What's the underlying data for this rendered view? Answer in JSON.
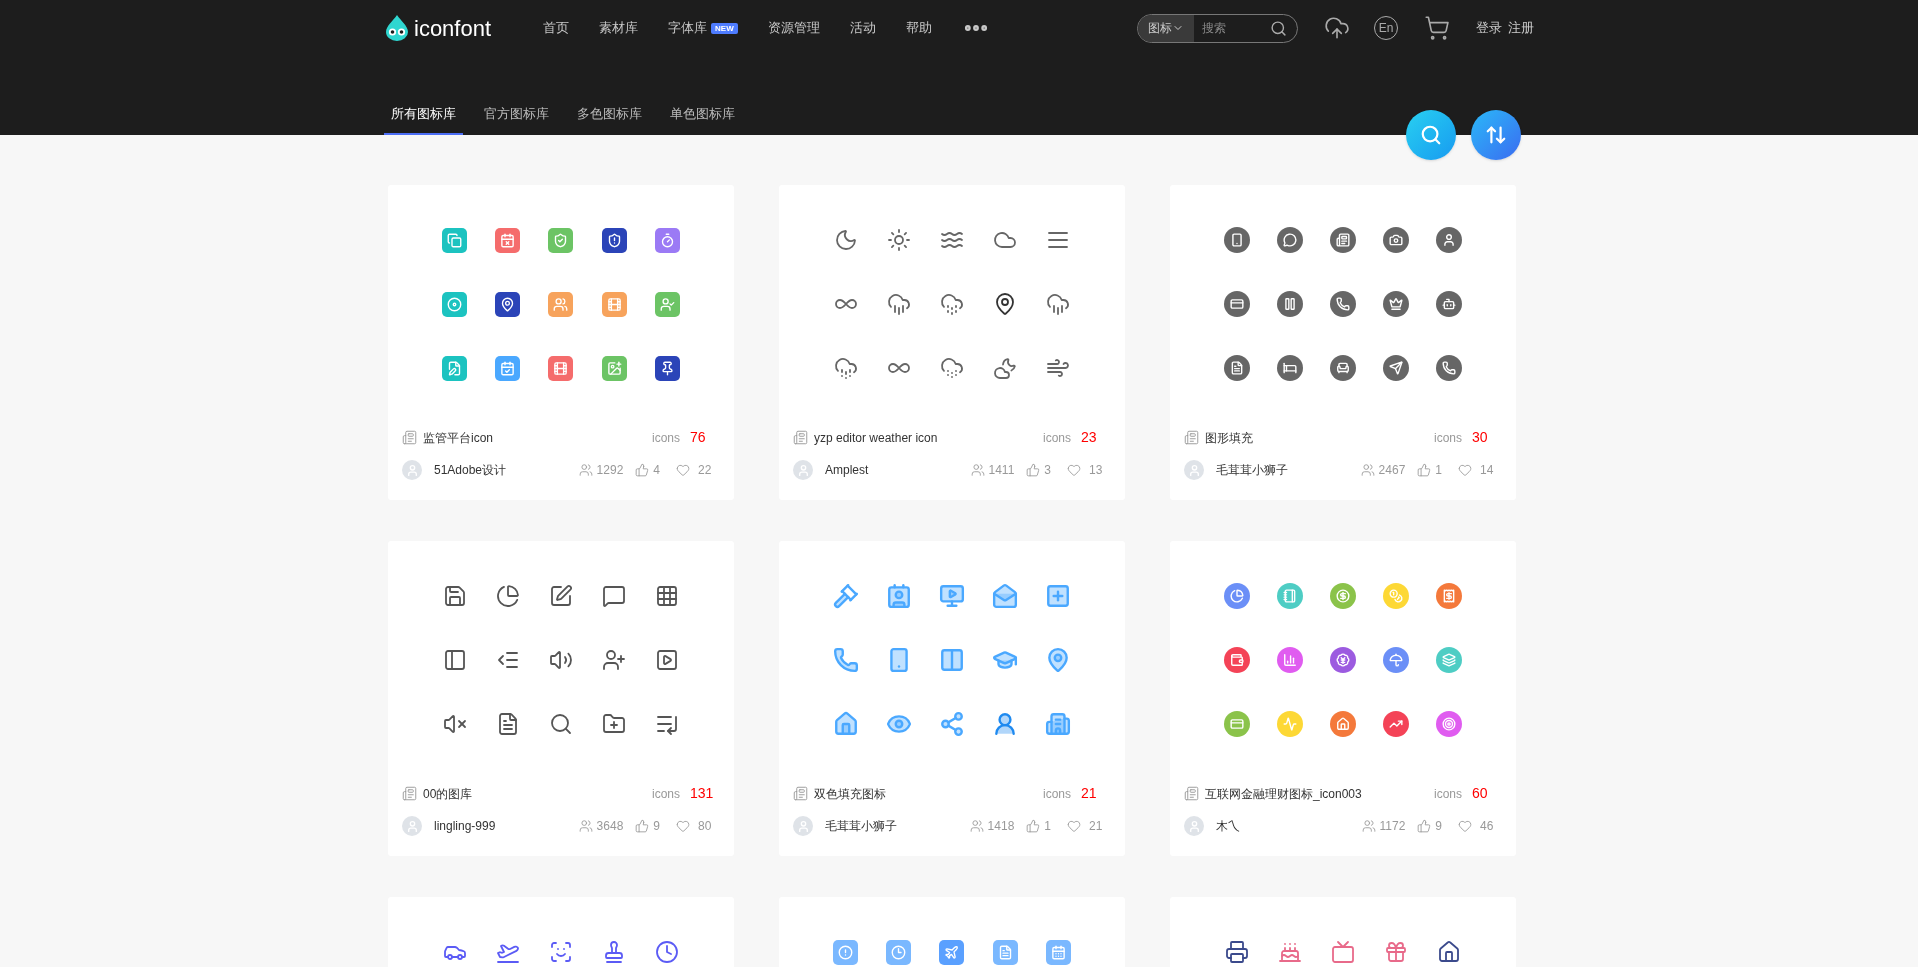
{
  "logo": {
    "text": "iconfont"
  },
  "nav": [
    {
      "label": "首页"
    },
    {
      "label": "素材库"
    },
    {
      "label": "字体库",
      "badge": "NEW"
    },
    {
      "label": "资源管理"
    },
    {
      "label": "活动"
    },
    {
      "label": "帮助"
    }
  ],
  "search": {
    "scope": "图标",
    "placeholder": "搜索"
  },
  "language": "En",
  "account": {
    "login": "登录",
    "register": "注册"
  },
  "tabs": [
    {
      "label": "所有图标库",
      "selected": true
    },
    {
      "label": "官方图标库",
      "selected": false
    },
    {
      "label": "多色图标库",
      "selected": false
    },
    {
      "label": "单色图标库",
      "selected": false
    }
  ],
  "cards": [
    {
      "kind": "tile",
      "title": "监管平台icon",
      "icons_label": "icons",
      "count": "76",
      "author": "51Adobe设计",
      "followers": "1292",
      "likes": "4",
      "favorites": "22",
      "icons": [
        {
          "color": "#1cc3c0"
        },
        {
          "color": "#f56c6c"
        },
        {
          "color": "#6cc465"
        },
        {
          "color": "#2b44b8"
        },
        {
          "color": "#9b7af5"
        },
        {
          "color": "#1cc3c0"
        },
        {
          "color": "#2b44b8"
        },
        {
          "color": "#f7a35c"
        },
        {
          "color": "#f7a35c"
        },
        {
          "color": "#6cc465"
        },
        {
          "color": "#1cc3c0"
        },
        {
          "color": "#4aa8ff"
        },
        {
          "color": "#f56c6c"
        },
        {
          "color": "#6cc465"
        },
        {
          "color": "#2b44b8"
        }
      ]
    },
    {
      "kind": "line",
      "title": "yzp editor weather icon",
      "icons_label": "icons",
      "count": "23",
      "author": "Amplest",
      "followers": "1411",
      "likes": "3",
      "favorites": "13",
      "icons": [
        {
          "color": "#666666"
        },
        {
          "color": "#666666"
        },
        {
          "color": "#666666"
        },
        {
          "color": "#666666"
        },
        {
          "color": "#666666"
        },
        {
          "color": "#666666"
        },
        {
          "color": "#666666"
        },
        {
          "color": "#666666"
        },
        {
          "color": "#333333"
        },
        {
          "color": "#666666"
        },
        {
          "color": "#666666"
        },
        {
          "color": "#666666"
        },
        {
          "color": "#666666"
        },
        {
          "color": "#666666"
        },
        {
          "color": "#666666"
        }
      ]
    },
    {
      "kind": "circle",
      "title": "图形填充",
      "icons_label": "icons",
      "count": "30",
      "author": "毛茸茸小狮子",
      "followers": "2467",
      "likes": "1",
      "favorites": "14",
      "icons": [
        {
          "color": "#666666"
        },
        {
          "color": "#666666"
        },
        {
          "color": "#666666"
        },
        {
          "color": "#666666"
        },
        {
          "color": "#666666"
        },
        {
          "color": "#666666"
        },
        {
          "color": "#666666"
        },
        {
          "color": "#666666"
        },
        {
          "color": "#666666"
        },
        {
          "color": "#666666"
        },
        {
          "color": "#666666"
        },
        {
          "color": "#666666"
        },
        {
          "color": "#666666"
        },
        {
          "color": "#666666"
        },
        {
          "color": "#666666"
        }
      ]
    },
    {
      "kind": "line",
      "title": "00的图库",
      "icons_label": "icons",
      "count": "131",
      "author": "lingling-999",
      "followers": "3648",
      "likes": "9",
      "favorites": "80",
      "icons": [
        {
          "color": "#555555"
        },
        {
          "color": "#555555"
        },
        {
          "color": "#555555"
        },
        {
          "color": "#555555"
        },
        {
          "color": "#555555"
        },
        {
          "color": "#555555"
        },
        {
          "color": "#555555"
        },
        {
          "color": "#555555"
        },
        {
          "color": "#555555"
        },
        {
          "color": "#555555"
        },
        {
          "color": "#555555"
        },
        {
          "color": "#555555"
        },
        {
          "color": "#555555"
        },
        {
          "color": "#555555"
        },
        {
          "color": "#555555"
        }
      ]
    },
    {
      "kind": "duotone",
      "title": "双色填充图标",
      "icons_label": "icons",
      "count": "21",
      "author": "毛茸茸小狮子",
      "followers": "1418",
      "likes": "1",
      "favorites": "21",
      "icons": [
        {
          "color": "#4aa8ff"
        },
        {
          "color": "#4aa8ff"
        },
        {
          "color": "#4aa8ff"
        },
        {
          "color": "#4aa8ff"
        },
        {
          "color": "#4aa8ff"
        },
        {
          "color": "#4aa8ff"
        },
        {
          "color": "#4aa8ff"
        },
        {
          "color": "#4aa8ff"
        },
        {
          "color": "#4aa8ff"
        },
        {
          "color": "#4aa8ff"
        },
        {
          "color": "#4aa8ff"
        },
        {
          "color": "#4aa8ff"
        },
        {
          "color": "#4aa8ff"
        },
        {
          "color": "#1f8af0"
        },
        {
          "color": "#4aa8ff"
        }
      ]
    },
    {
      "kind": "circle",
      "title": "互联网金融理财图标_icon003",
      "icons_label": "icons",
      "count": "60",
      "author": "木乀",
      "followers": "1172",
      "likes": "9",
      "favorites": "46",
      "icons": [
        {
          "color": "#6b8ff7"
        },
        {
          "color": "#4ecdc4"
        },
        {
          "color": "#8bc34a"
        },
        {
          "color": "#fdd835"
        },
        {
          "color": "#f4793b"
        },
        {
          "color": "#f44357"
        },
        {
          "color": "#e05cf0"
        },
        {
          "color": "#9c5be0"
        },
        {
          "color": "#6b8ff7"
        },
        {
          "color": "#4ecdc4"
        },
        {
          "color": "#8bc34a"
        },
        {
          "color": "#fdd835"
        },
        {
          "color": "#f4793b"
        },
        {
          "color": "#f44357"
        },
        {
          "color": "#e05cf0"
        }
      ]
    },
    {
      "kind": "line",
      "icons": [
        {
          "color": "#5b5bf5"
        },
        {
          "color": "#5b5bf5"
        },
        {
          "color": "#5b5bf5"
        },
        {
          "color": "#5b5bf5"
        },
        {
          "color": "#5b5bf5"
        }
      ]
    },
    {
      "kind": "tile",
      "icons": [
        {
          "color": "#7ab8ff"
        },
        {
          "color": "#7ab8ff"
        },
        {
          "color": "#5aa0ff"
        },
        {
          "color": "#7ab8ff"
        },
        {
          "color": "#7ab8ff"
        }
      ]
    },
    {
      "kind": "line",
      "icons": [
        {
          "color": "#3b4a8c"
        },
        {
          "color": "#e86a8a"
        },
        {
          "color": "#e86a8a"
        },
        {
          "color": "#e86a8a"
        },
        {
          "color": "#3b4a8c"
        }
      ]
    }
  ]
}
